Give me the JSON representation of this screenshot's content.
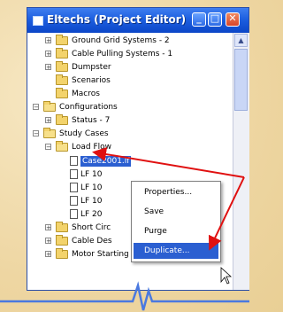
{
  "window": {
    "title": "Eltechs (Project Editor)"
  },
  "tree": {
    "items": [
      {
        "label": "Ground Grid Systems - 2",
        "kind": "folder"
      },
      {
        "label": "Cable Pulling Systems - 1",
        "kind": "folder"
      },
      {
        "label": "Dumpster",
        "kind": "folder"
      },
      {
        "label": "Scenarios",
        "kind": "folder"
      },
      {
        "label": "Macros",
        "kind": "folder"
      },
      {
        "label": "Configurations",
        "kind": "folder"
      },
      {
        "label": "Status - 7",
        "kind": "folder"
      },
      {
        "label": "Study Cases",
        "kind": "folder"
      },
      {
        "label": "Load Flow",
        "kind": "folder"
      },
      {
        "label": "Case2001.lf",
        "kind": "doc"
      },
      {
        "label": "LF 10",
        "kind": "doc"
      },
      {
        "label": "LF 10",
        "kind": "doc"
      },
      {
        "label": "LF 10",
        "kind": "doc"
      },
      {
        "label": "LF 20",
        "kind": "doc"
      },
      {
        "label": "Short Circ",
        "kind": "folder"
      },
      {
        "label": "Cable Des",
        "kind": "folder"
      },
      {
        "label": "Motor Starting - 1",
        "kind": "folder"
      }
    ]
  },
  "context_menu": {
    "items": [
      "Properties...",
      "Save",
      "Purge",
      "Duplicate..."
    ],
    "highlighted": "Duplicate..."
  },
  "colors": {
    "accent": "#2b5fd1",
    "arrow": "#e01010"
  }
}
